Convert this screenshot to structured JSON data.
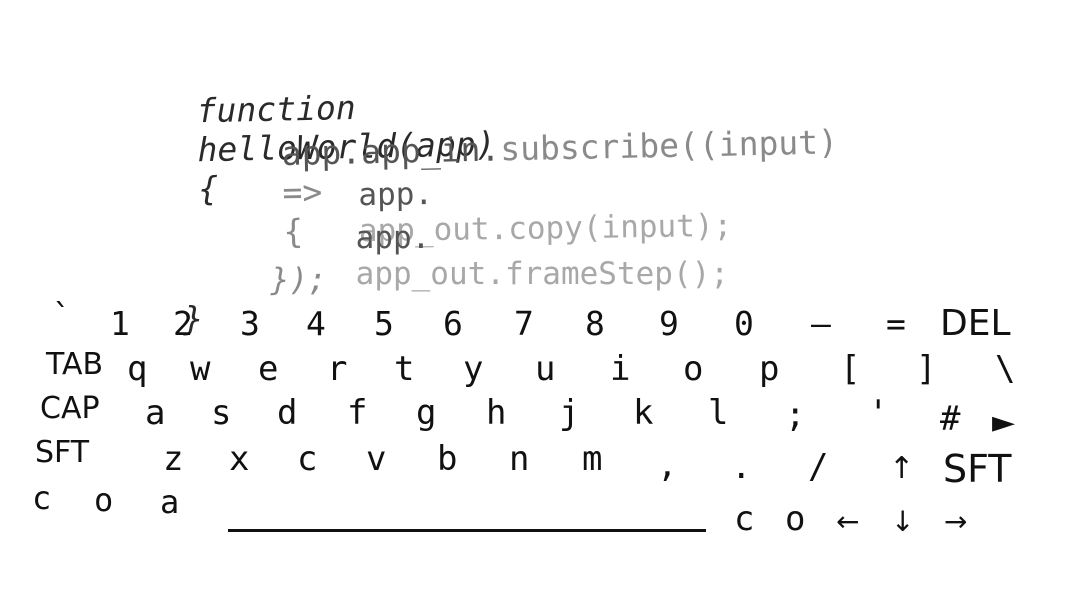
{
  "code": {
    "line1": {
      "keyword": "function",
      "name": "helloWorld(app)",
      "brace": "{"
    },
    "line2": {
      "obj": "app.",
      "prop": "app_in.",
      "method": "subscribe((input)",
      "arrow": "=>",
      "brace": "{"
    },
    "line3": {
      "obj": "app.",
      "prop": "app_out.",
      "method": "copy(input);"
    },
    "line4": {
      "obj": "app.",
      "prop": "app_out.",
      "method": "frameStep();"
    },
    "line5": {
      "close": "});"
    },
    "line6": {
      "close": "}"
    }
  },
  "keyboard": {
    "row1": [
      "`",
      "1",
      "2",
      "3",
      "4",
      "5",
      "6",
      "7",
      "8",
      "9",
      "0",
      "–",
      "=",
      "DEL"
    ],
    "row2": [
      "TAB",
      "q",
      "w",
      "e",
      "r",
      "t",
      "y",
      "u",
      "i",
      "o",
      "p",
      "[",
      "]",
      "\\"
    ],
    "row3": [
      "CAP",
      "a",
      "s",
      "d",
      "f",
      "g",
      "h",
      "j",
      "k",
      "l",
      ";",
      "'",
      "#",
      "►"
    ],
    "row4": [
      "SFT",
      "z",
      "x",
      "c",
      "v",
      "b",
      "n",
      "m",
      ",",
      ".",
      "/",
      "↑",
      "SFT"
    ],
    "row5": [
      "c",
      "o",
      "a",
      "c",
      "o",
      "←",
      "↓",
      "→"
    ]
  }
}
